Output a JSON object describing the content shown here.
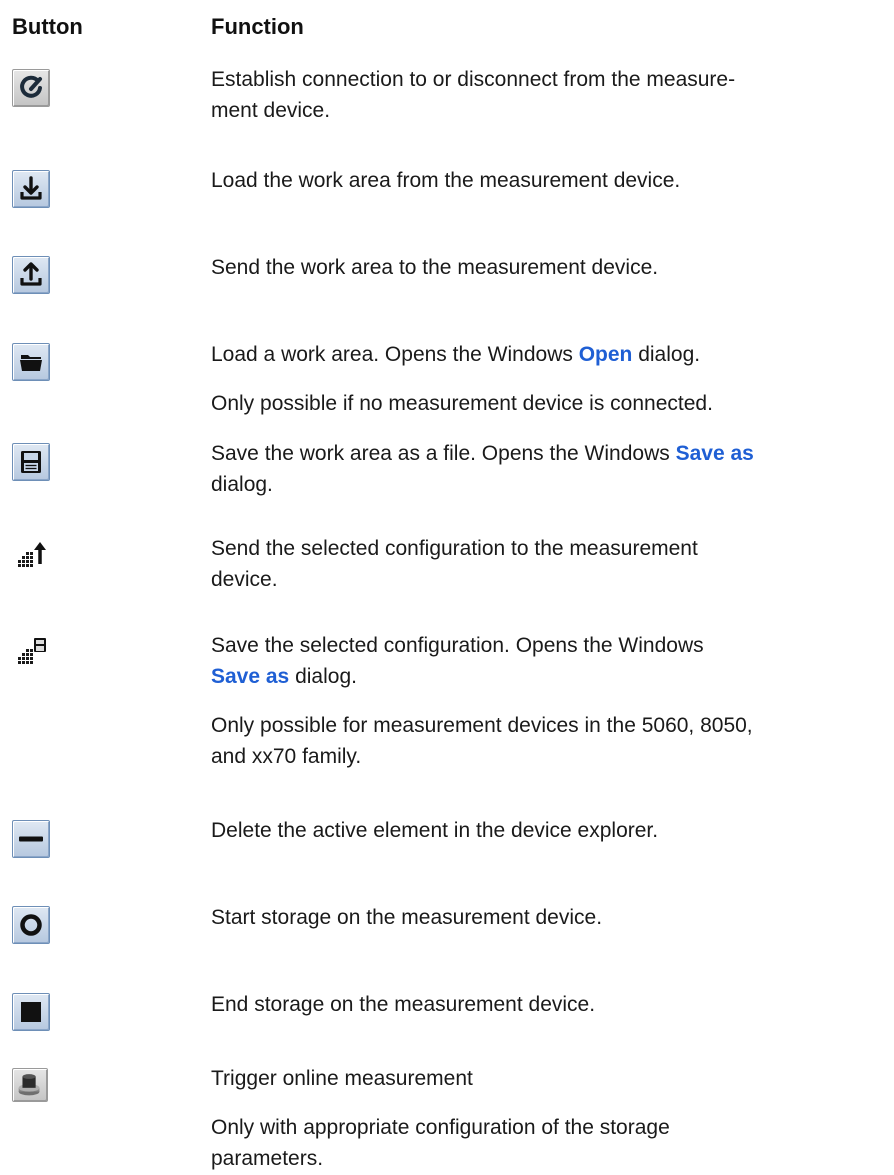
{
  "header": {
    "button": "Button",
    "function": "Function"
  },
  "rows": [
    {
      "icon": "connect-icon",
      "text": [
        "Establish connection to or disconnect from the measure-",
        "ment device."
      ]
    },
    {
      "icon": "download-icon",
      "text": [
        "Load the work area from the measurement device."
      ]
    },
    {
      "icon": "upload-icon",
      "text": [
        "Send the work area to the measurement device."
      ]
    },
    {
      "icon": "folder-open-icon",
      "text": {
        "p1_before": "Load a work area. Opens the Windows ",
        "p1_keyword": "Open",
        "p1_after": " dialog.",
        "p2": "Only possible if no measurement device is connected."
      }
    },
    {
      "icon": "save-disk-icon",
      "text": {
        "p1_before": "Save the work area as a file. Opens the Windows ",
        "p1_keyword": "Save as",
        "p1_after": "dialog."
      }
    },
    {
      "icon": "send-config-icon",
      "text": [
        "Send the selected configuration to the measurement",
        "device."
      ]
    },
    {
      "icon": "save-config-icon",
      "text": {
        "p1_line1": "Save the selected configuration. Opens the Windows",
        "p1_keyword": "Save as",
        "p1_after": " dialog.",
        "p2_line1": "Only possible for measurement devices in the 5060, 8050,",
        "p2_line2": "and xx70 family."
      }
    },
    {
      "icon": "delete-minus-icon",
      "text": [
        "Delete the active element in the device explorer."
      ]
    },
    {
      "icon": "record-circle-icon",
      "text": [
        "Start storage on the measurement device."
      ]
    },
    {
      "icon": "stop-square-icon",
      "text": [
        "End storage on the measurement device."
      ]
    },
    {
      "icon": "trigger-button-icon",
      "text": {
        "p1": "Trigger online measurement",
        "p2_line1": "Only with appropriate configuration of the storage",
        "p2_line2": "parameters."
      }
    }
  ]
}
